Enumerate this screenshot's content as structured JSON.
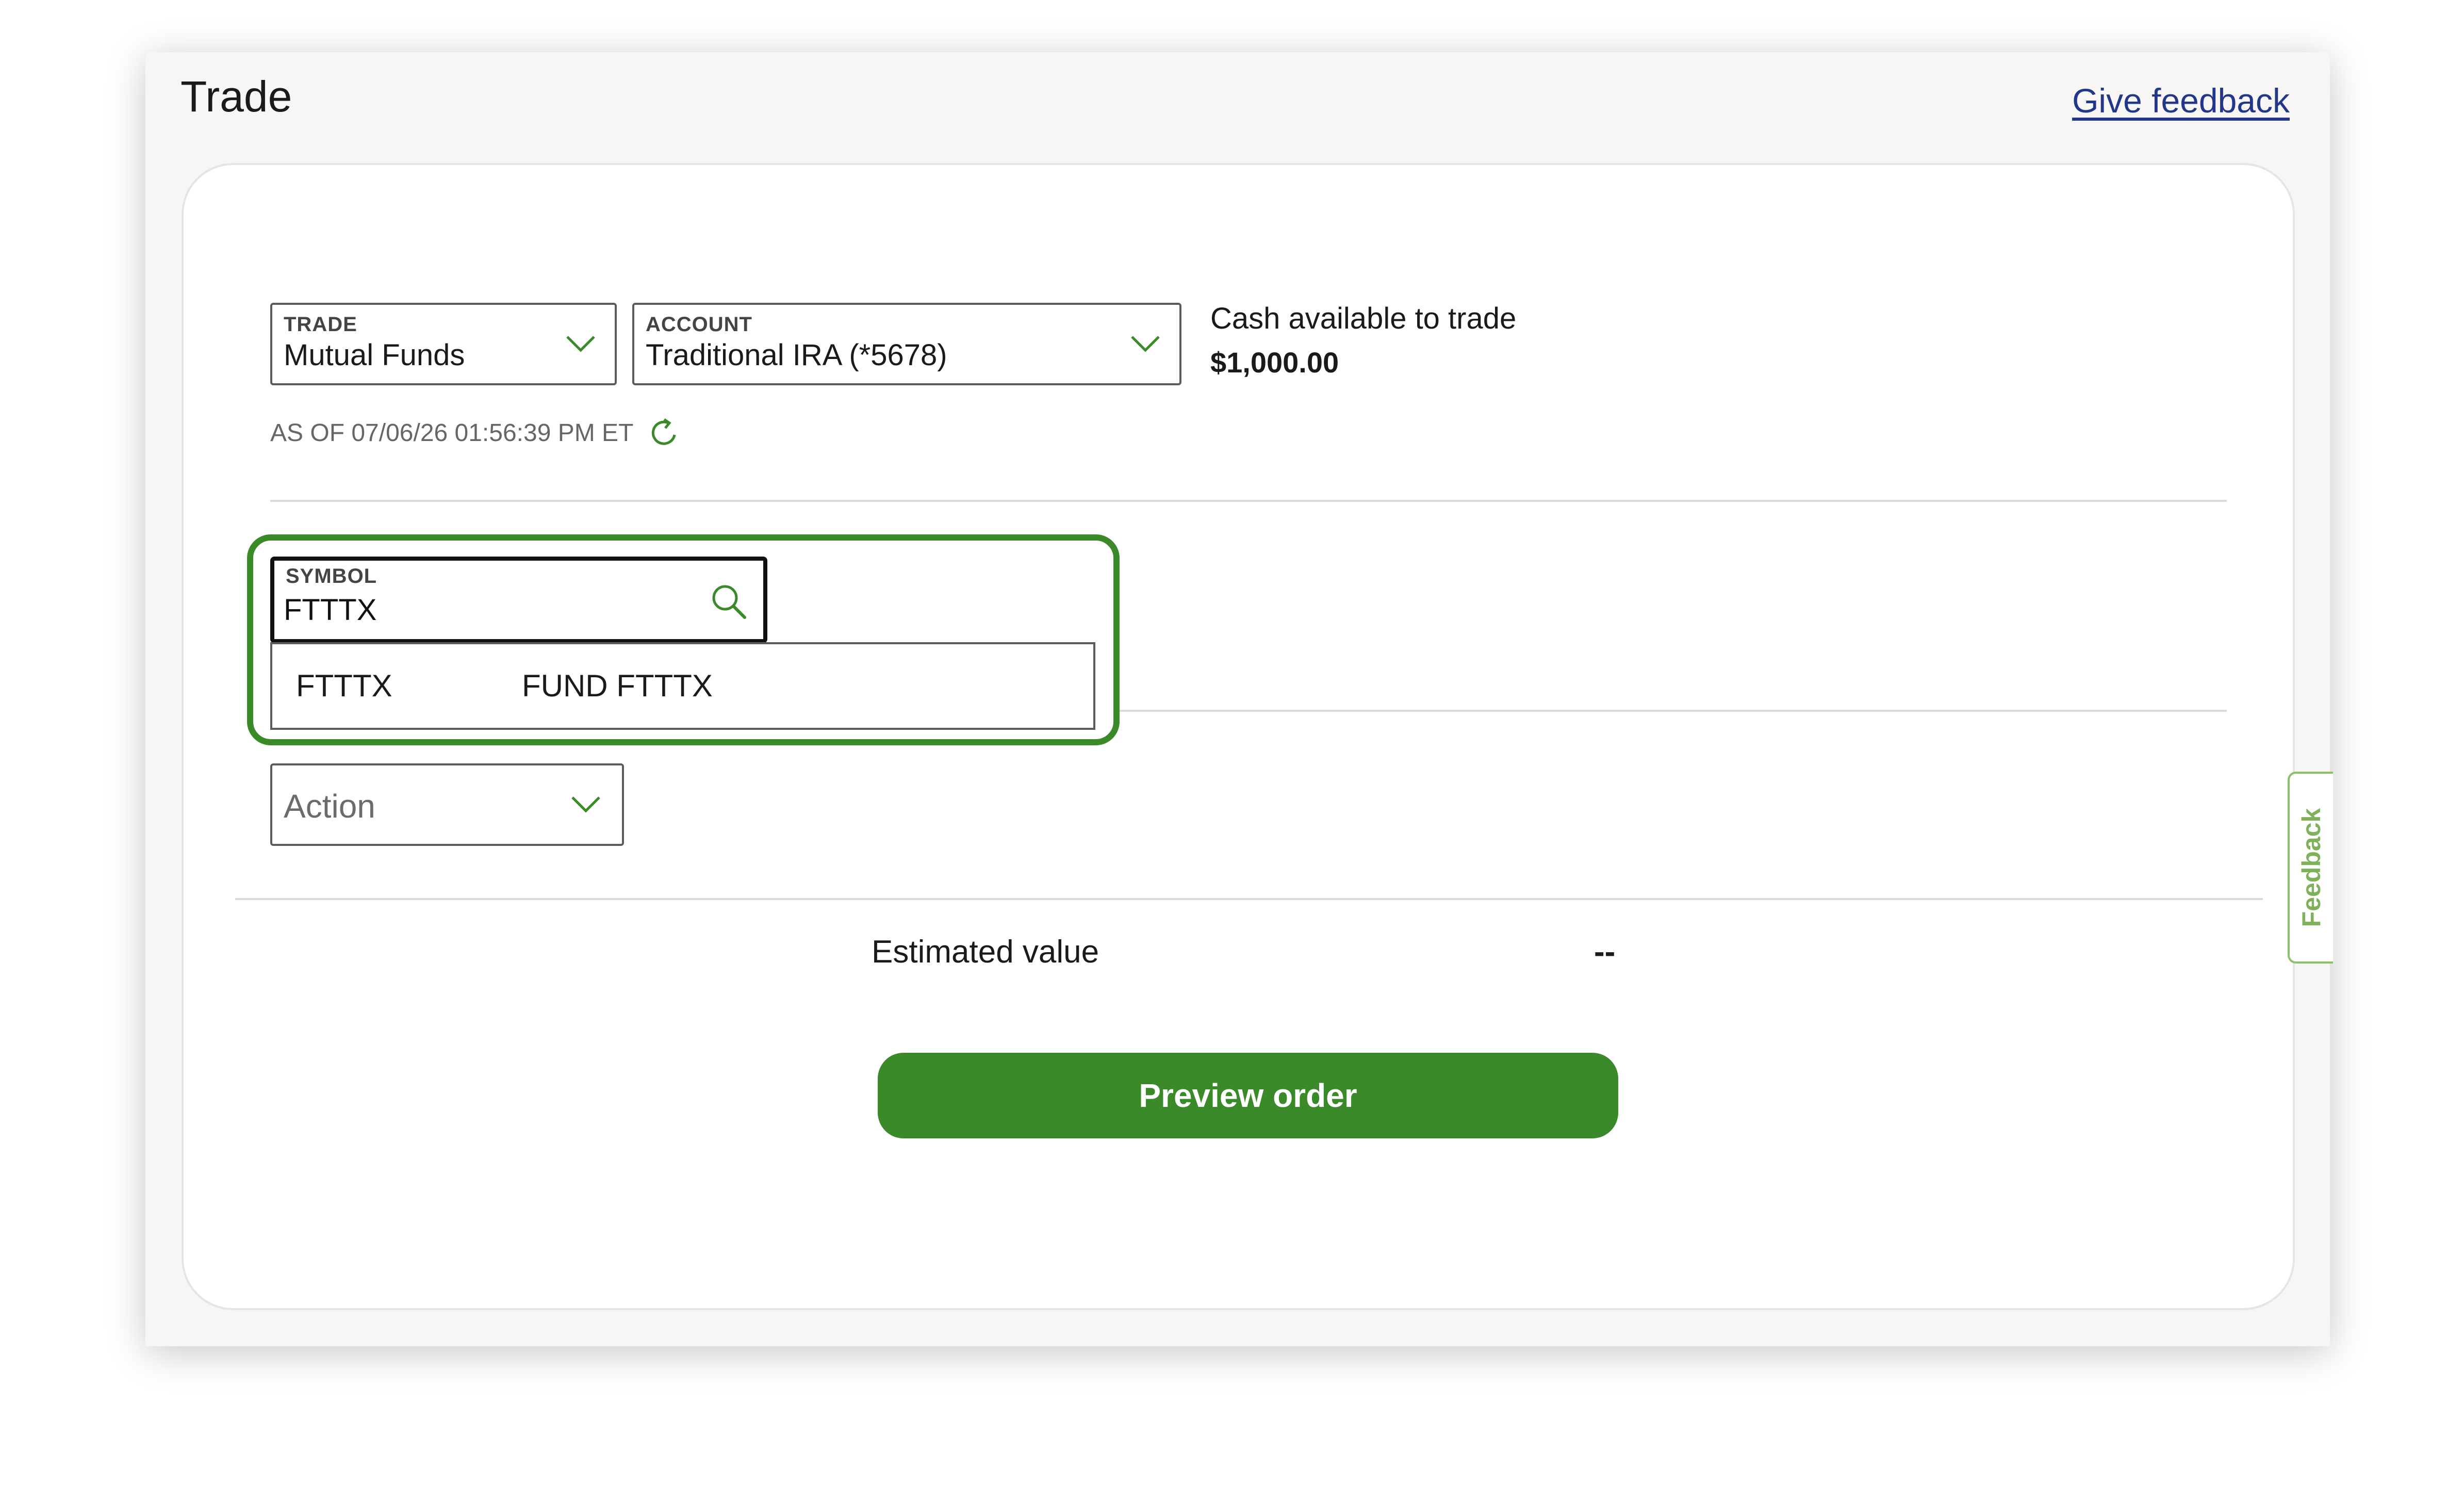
{
  "header": {
    "title": "Trade",
    "give_feedback": "Give feedback"
  },
  "trade_select": {
    "label": "TRADE",
    "value": "Mutual Funds"
  },
  "account_select": {
    "label": "ACCOUNT",
    "value": "Traditional IRA (*5678)"
  },
  "cash": {
    "label": "Cash available to trade",
    "value": "$1,000.00"
  },
  "as_of": "AS OF 07/06/26 01:56:39 PM ET",
  "symbol": {
    "label": "SYMBOL",
    "value": "FTTTX"
  },
  "dropdown": {
    "options": [
      {
        "symbol": "FTTTX",
        "name": "FUND FTTTX"
      }
    ]
  },
  "action_select": {
    "placeholder": "Action"
  },
  "estimate": {
    "label": "Estimated value",
    "value": "--"
  },
  "preview_button": "Preview order",
  "feedback_tab": "Feedback",
  "colors": {
    "accent_green": "#3a8a2a",
    "link_blue": "#23378a",
    "feedback_green": "#7fb05a"
  },
  "icons": {
    "chevron": "chevron-down-icon",
    "search": "search-icon",
    "refresh": "refresh-icon"
  }
}
